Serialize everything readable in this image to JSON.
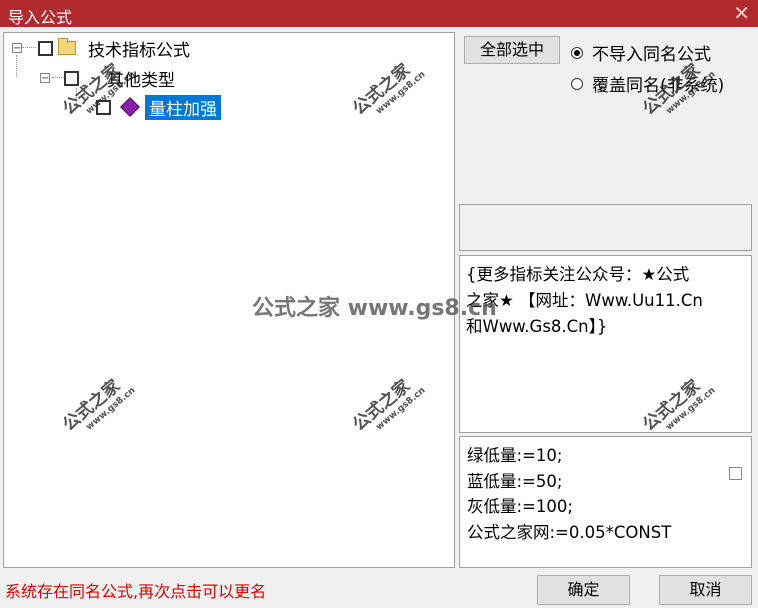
{
  "window": {
    "title": "导入公式",
    "close": "✕"
  },
  "tree": {
    "root_label": "技术指标公式",
    "group_label": "其他类型",
    "item_label": "量柱加强",
    "expander_minus": "−"
  },
  "buttons": {
    "select_all": "全部选中",
    "ok": "确定",
    "cancel": "取消"
  },
  "options": {
    "no_import_same": "不导入同名公式",
    "overwrite_same": "覆盖同名(非系统)",
    "selected": "no_import_same"
  },
  "info": {
    "line1": "{更多指标关注公众号：★公式",
    "line2": "之家★ 【网址：Www.Uu11.Cn",
    "line3": "和Www.Gs8.Cn】}"
  },
  "code": {
    "lines": [
      "绿低量:=10;",
      "蓝低量:=50;",
      "灰低量:=100;",
      "公式之家网:=0.05*CONST"
    ]
  },
  "status": "系统存在同名公式,再次点击可以更名",
  "watermark": {
    "text": "公式之家",
    "url": "www.gs8.cn",
    "center": "公式之家 www.gs8.cn"
  }
}
